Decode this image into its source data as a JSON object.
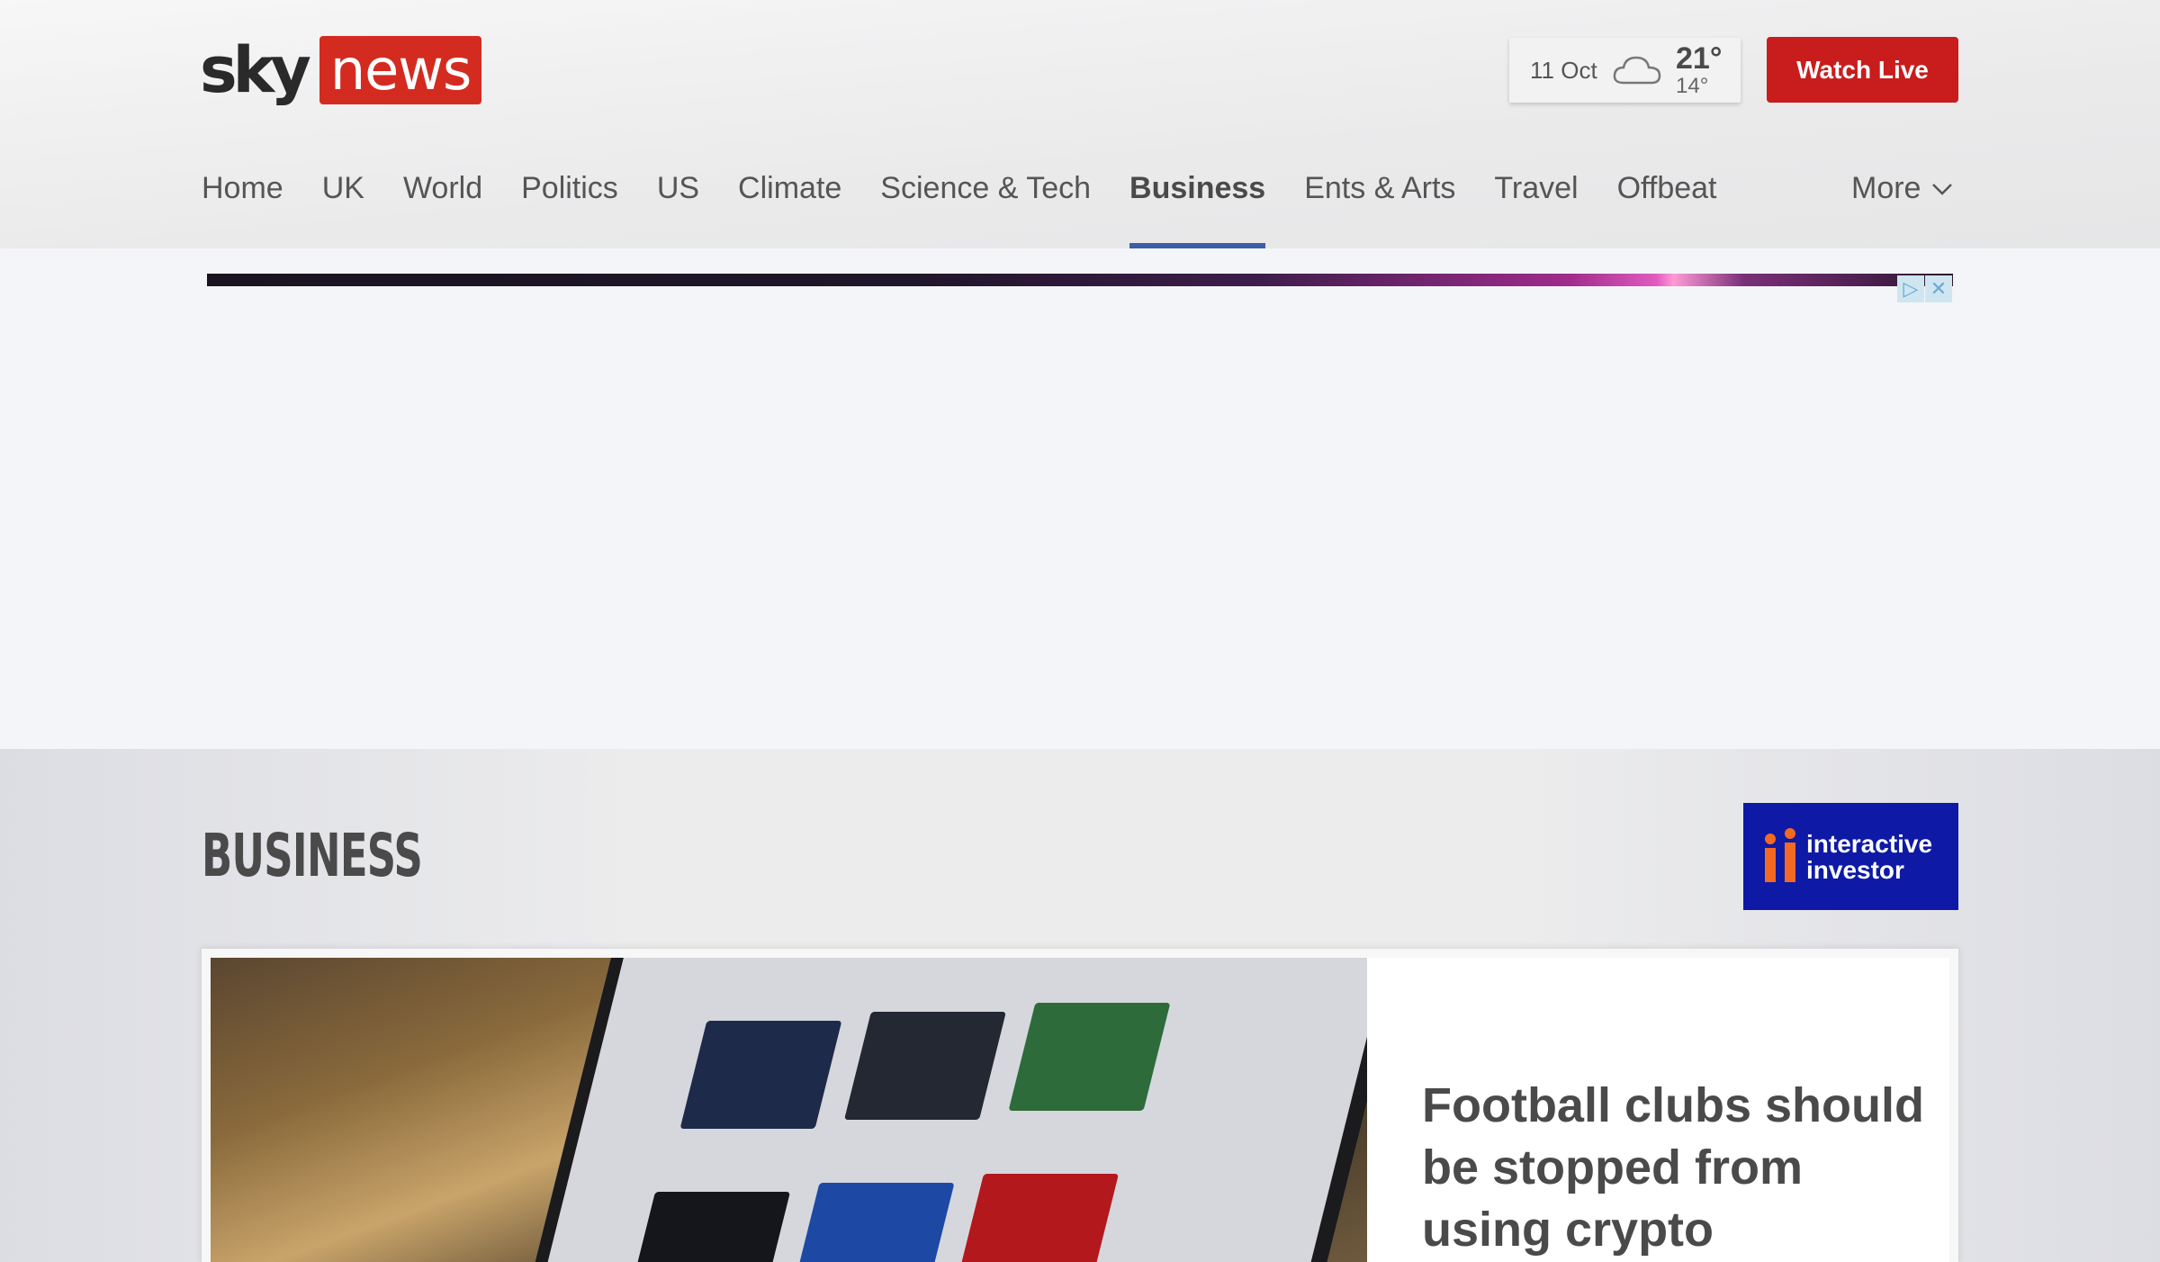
{
  "header": {
    "logo": {
      "sky": "sky",
      "news": "news"
    },
    "weather": {
      "date": "11 Oct",
      "icon": "cloud-icon",
      "high": "21°",
      "low": "14°"
    },
    "watch_live": "Watch Live"
  },
  "nav": {
    "items": [
      {
        "label": "Home",
        "active": false
      },
      {
        "label": "UK",
        "active": false
      },
      {
        "label": "World",
        "active": false
      },
      {
        "label": "Politics",
        "active": false
      },
      {
        "label": "US",
        "active": false
      },
      {
        "label": "Climate",
        "active": false
      },
      {
        "label": "Science & Tech",
        "active": false
      },
      {
        "label": "Business",
        "active": true
      },
      {
        "label": "Ents & Arts",
        "active": false
      },
      {
        "label": "Travel",
        "active": false
      },
      {
        "label": "Offbeat",
        "active": false
      }
    ],
    "more": "More"
  },
  "ad": {
    "adchoices_icon": "adchoices-icon",
    "close_icon": "close-icon"
  },
  "section": {
    "title": "BUSINESS",
    "sponsor": {
      "line1": "interactive",
      "line2": "investor"
    }
  },
  "lead_story": {
    "headline": "Football clubs should be stopped from using crypto"
  },
  "colors": {
    "brand_red": "#d42b21",
    "watch_live": "#c91c1c",
    "active_underline": "#3a5fa8",
    "sponsor_blue": "#0e1aa6",
    "sponsor_orange": "#f26a21"
  }
}
